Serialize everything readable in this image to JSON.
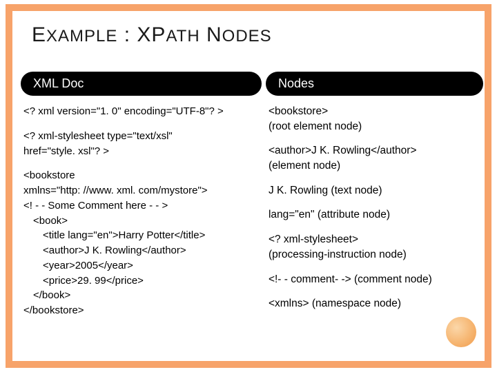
{
  "title_parts": {
    "e": "E",
    "xample": "XAMPLE",
    "colon": " : ",
    "xp": "XP",
    "ath": "ATH",
    "n": " N",
    "odes": "ODES"
  },
  "header_left": "XML Doc",
  "header_right": "Nodes",
  "xml_block1": "<? xml version=\"1. 0\" encoding=\"UTF-8\"? >",
  "xml_block2_l1": "<? xml-stylesheet type=\"text/xsl\"",
  "xml_block2_l2": "href=\"style. xsl\"? >",
  "xml": {
    "l1": "<bookstore",
    "l2": "xmlns=\"http: //www. xml. com/mystore\">",
    "l3": "<! - - Some Comment here - - >",
    "l4": "<book>",
    "l5": "<title lang=\"en\">Harry Potter</title>",
    "l6": "<author>J K. Rowling</author>",
    "l7": "<year>2005</year>",
    "l8": "<price>29. 99</price>",
    "l9": "</book>",
    "l10": "</bookstore>"
  },
  "nodes": {
    "n1a": "<bookstore>",
    "n1b": "(root element node)",
    "n2a": "<author>J K. Rowling</author>",
    "n2b": "(element node)",
    "n3": "J K. Rowling (text node)",
    "n4": "lang=\"en\" (attribute node)",
    "n5a": "<? xml-stylesheet>",
    "n5b": "(processing-instruction node)",
    "n6": "<!- - comment- ->  (comment node)",
    "n7": "<xmlns> (namespace node)"
  }
}
